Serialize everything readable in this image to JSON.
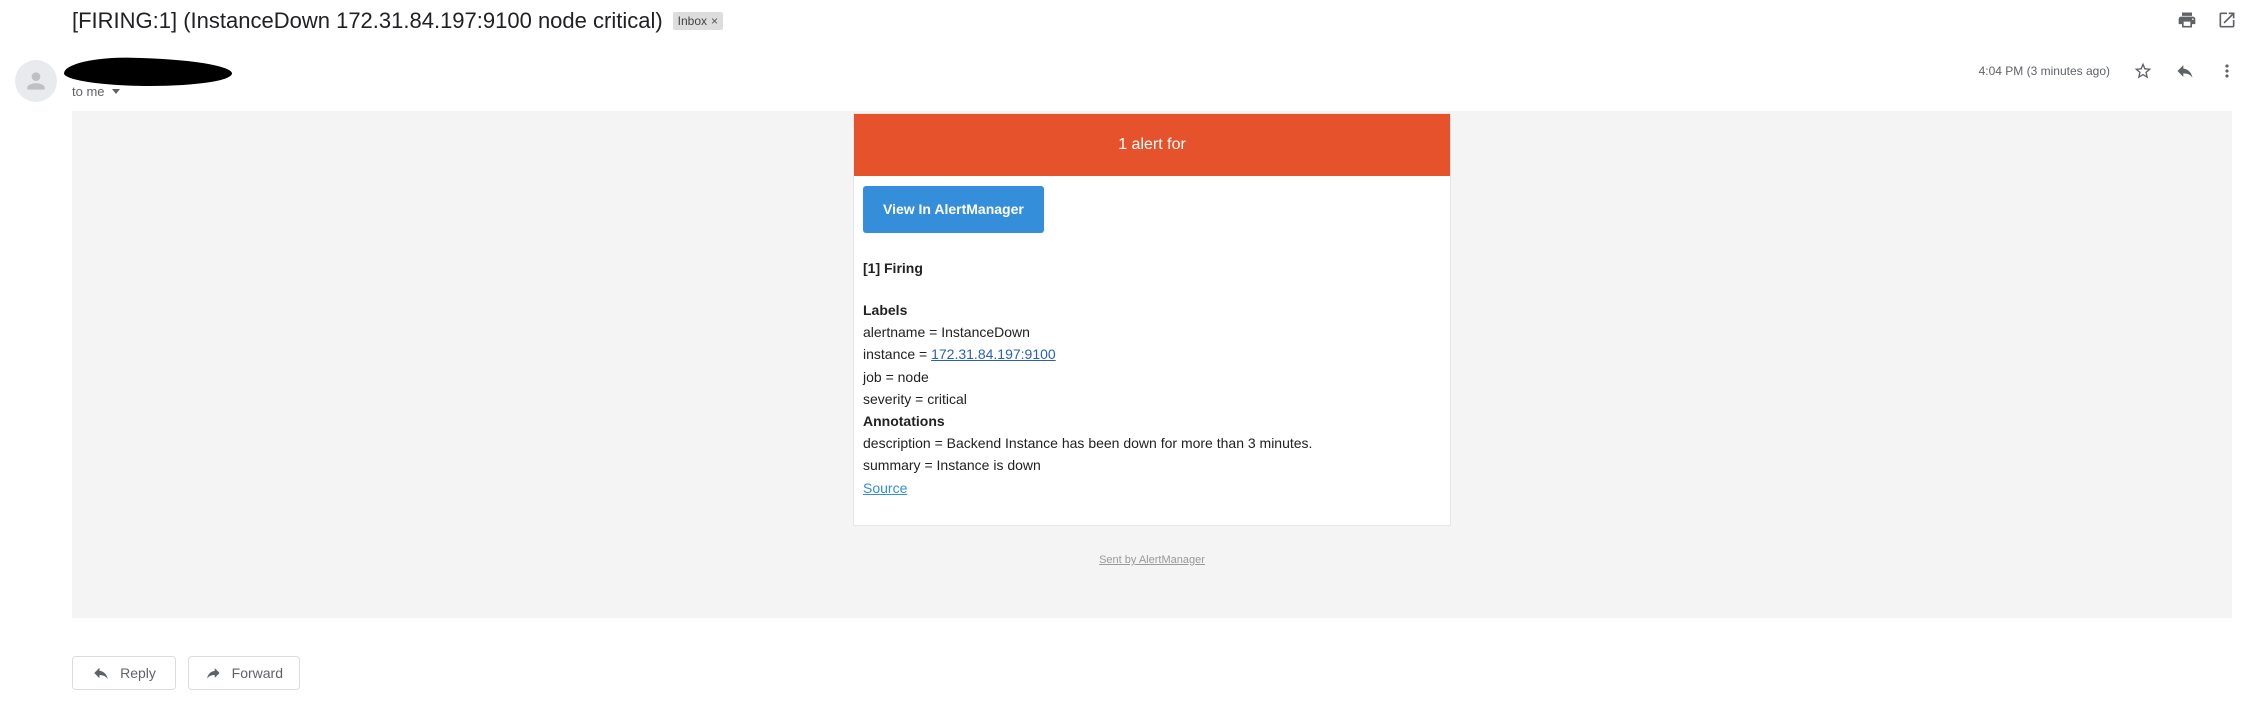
{
  "subject": "[FIRING:1] (InstanceDown 172.31.84.197:9100 node critical)",
  "label": "Inbox",
  "recipient": "to me",
  "timestamp": "4:04 PM (3 minutes ago)",
  "alert": {
    "header": "1 alert for",
    "button_label": "View In AlertManager",
    "firing": "[1] Firing",
    "labels_title": "Labels",
    "labels": [
      {
        "key": "alertname = ",
        "value": "InstanceDown"
      },
      {
        "key": "instance = ",
        "value": "172.31.84.197:9100"
      },
      {
        "key": "job = ",
        "value": "node"
      },
      {
        "key": "severity = ",
        "value": "critical"
      }
    ],
    "annotations_title": "Annotations",
    "annotations": [
      {
        "key": "description = ",
        "value": "Backend Instance has been down for more than 3 minutes."
      },
      {
        "key": "summary = ",
        "value": "Instance is down"
      }
    ],
    "source_link": "Source"
  },
  "footer": "Sent by AlertManager",
  "actions": {
    "reply": "Reply",
    "forward": "Forward"
  },
  "colors": {
    "alert_header": "#e6522c",
    "button": "#348eda"
  }
}
